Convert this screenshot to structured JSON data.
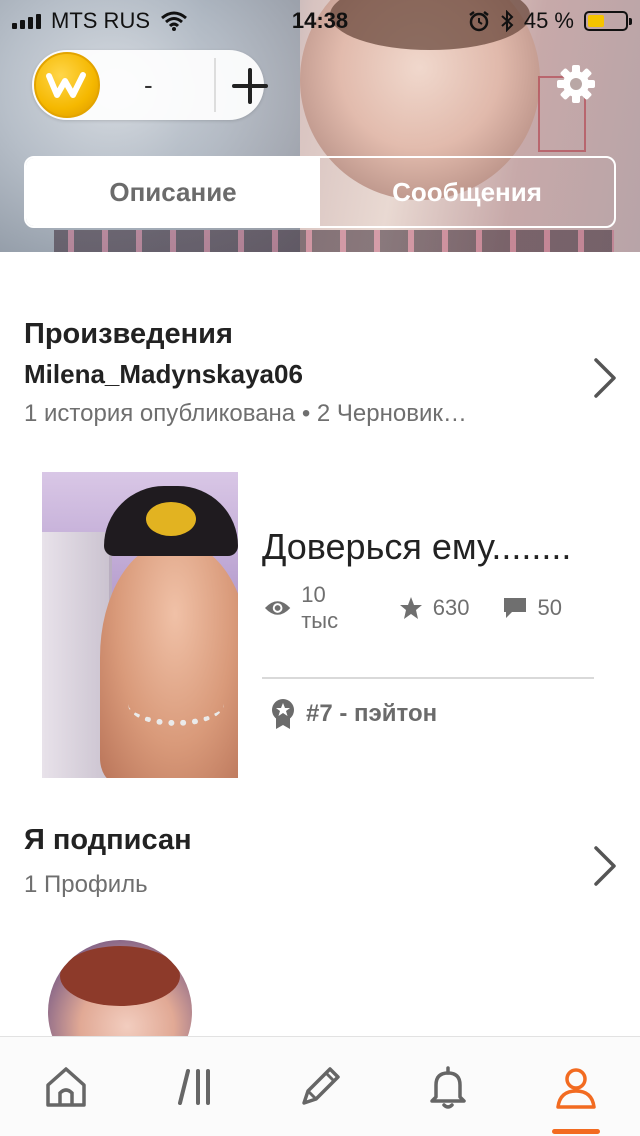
{
  "status_bar": {
    "carrier": "MTS RUS",
    "time": "14:38",
    "battery_percent": "45 %",
    "battery_level": 0.45
  },
  "header": {
    "coin_value": "-",
    "tabs": [
      {
        "label": "Описание",
        "active": true
      },
      {
        "label": "Сообщения",
        "active": false
      }
    ]
  },
  "works": {
    "title": "Произведения",
    "username": "Milena_Madynskaya06",
    "summary": "1 история опубликована • 2 Черновик…"
  },
  "story": {
    "title": "Доверься ему........",
    "views": "10 тыс",
    "votes": "630",
    "comments": "50",
    "rank_tag": "#7 - пэйтон"
  },
  "following": {
    "title": "Я подписан",
    "count": "1 Профиль"
  },
  "colors": {
    "accent": "#f26b21",
    "coin": "#f5b800",
    "text_primary": "#222222",
    "text_secondary": "#6f6f6f"
  },
  "bottom_nav": {
    "items": [
      "home-icon",
      "library-icon",
      "write-icon",
      "notifications-icon",
      "profile-icon"
    ],
    "active": "profile-icon"
  }
}
